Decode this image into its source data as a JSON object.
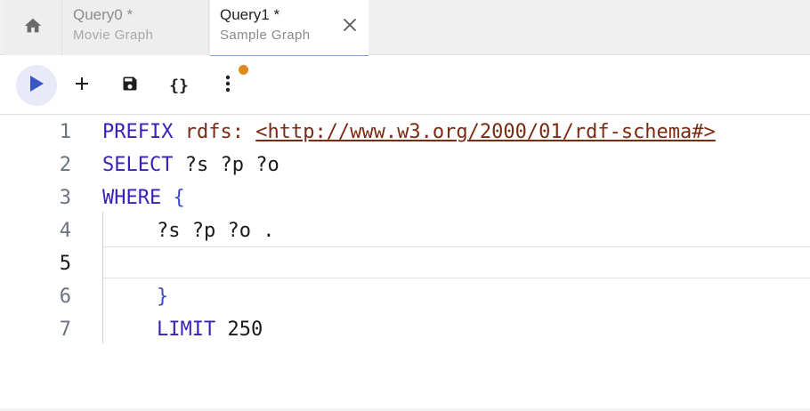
{
  "tabs": [
    {
      "title": "Query0 *",
      "subtitle": "Movie Graph",
      "active": false
    },
    {
      "title": "Query1 *",
      "subtitle": "Sample Graph",
      "active": true
    }
  ],
  "icons": {
    "home": "home-icon",
    "close": "close-icon",
    "run": "play-icon",
    "add": "plus-icon",
    "save": "save-icon",
    "format": "braces-icon",
    "more": "more-vert-icon"
  },
  "toolbar": {
    "format_label": "{}"
  },
  "colors": {
    "keyword": "#3b1fb8",
    "prefix": "#7a2b11",
    "brace": "#3b4cc0",
    "run_button_bg": "#e8ebf7",
    "run_icon": "#3a56c5",
    "unsaved_dot": "#e08a1e"
  },
  "editor": {
    "active_line": 5,
    "lines": [
      {
        "num": "1",
        "parts": {
          "kw": "PREFIX",
          "pfx": "rdfs:",
          "iri": "<http://www.w3.org/2000/01/rdf-schema#>"
        }
      },
      {
        "num": "2",
        "parts": {
          "kw": "SELECT",
          "rest": "?s ?p ?o"
        }
      },
      {
        "num": "3",
        "parts": {
          "kw": "WHERE",
          "brace": "{"
        }
      },
      {
        "num": "4",
        "parts": {
          "rest": "?s ?p ?o ."
        }
      },
      {
        "num": "5",
        "parts": {
          "rest": ""
        }
      },
      {
        "num": "6",
        "parts": {
          "brace": "}"
        }
      },
      {
        "num": "7",
        "parts": {
          "kw": "LIMIT",
          "rest": "250"
        }
      }
    ]
  }
}
